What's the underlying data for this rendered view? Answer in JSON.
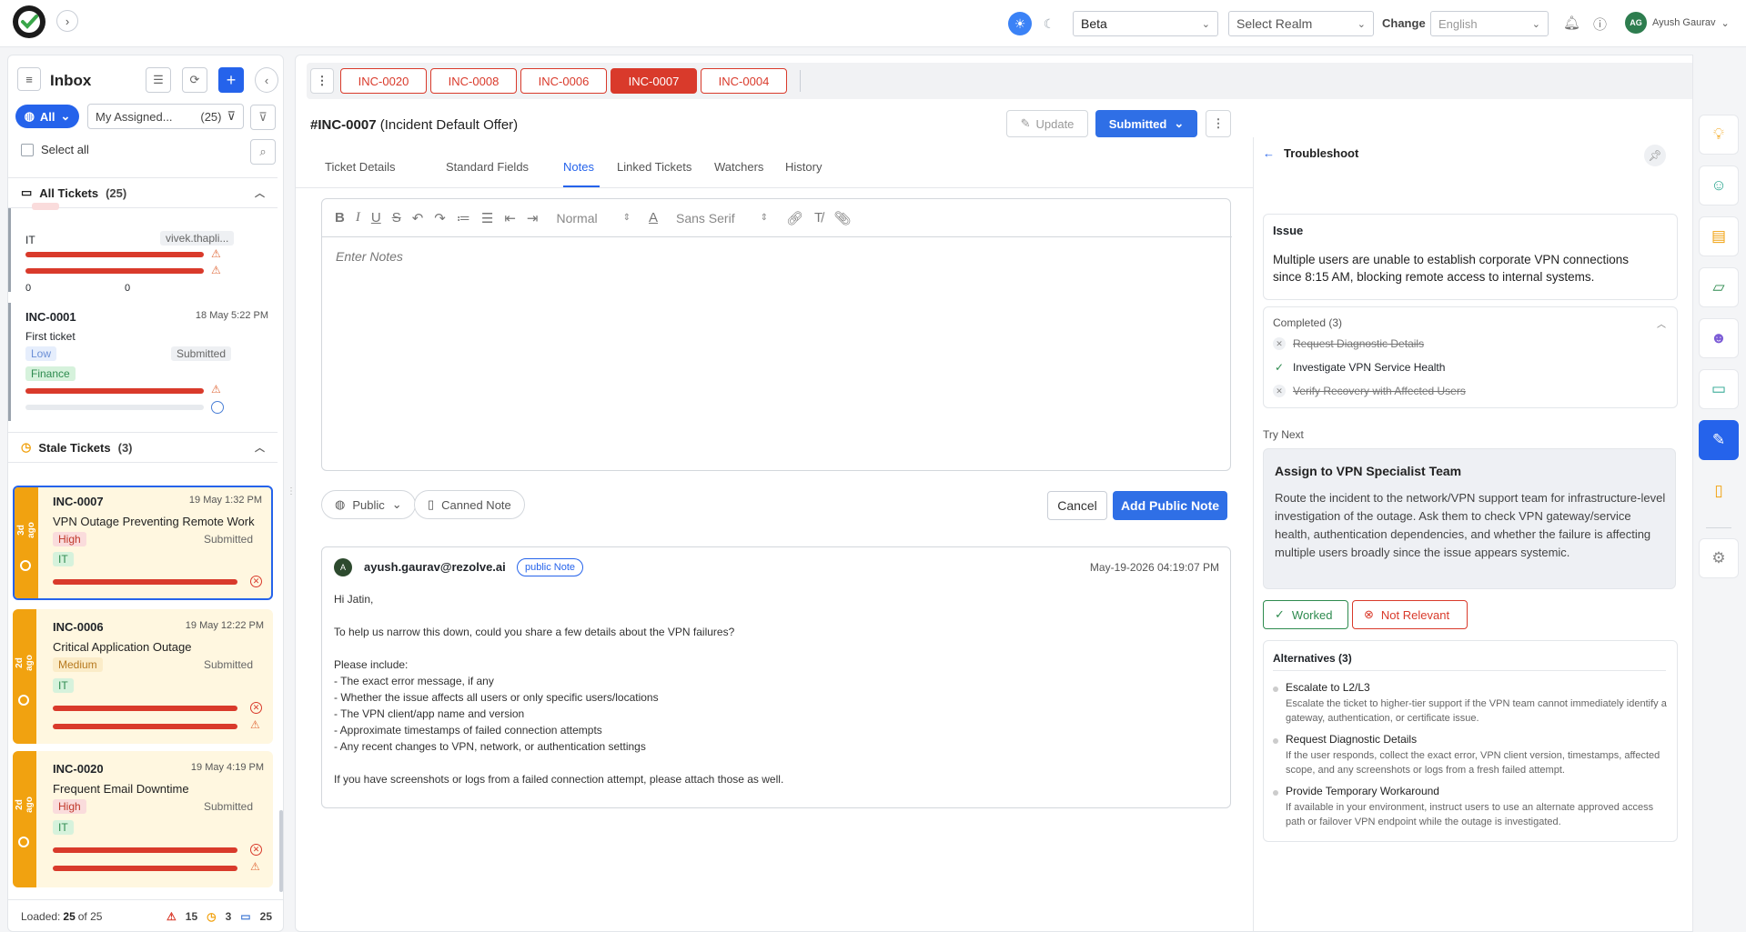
{
  "topbar": {
    "env": "Beta",
    "realm_placeholder": "Select Realm",
    "change_label": "Change",
    "language": "English",
    "user_initials": "AG",
    "user_name": "Ayush Gaurav"
  },
  "inbox": {
    "title": "Inbox",
    "all_label": "All",
    "my_assigned": "My Assigned...",
    "my_assigned_count": "(25)",
    "select_all": "Select all",
    "all_tickets": {
      "label": "All Tickets",
      "count": "(25)"
    },
    "partial_ticket": {
      "dept": "IT",
      "assignee": "vivek.thapli...",
      "count_a": "0",
      "count_b": "0"
    },
    "tickets": [
      {
        "id": "INC-0001",
        "date": "18 May 5:22 PM",
        "title": "First ticket",
        "priority": "Low",
        "status": "Submitted",
        "dept": "Finance"
      }
    ],
    "stale_tickets": {
      "label": "Stale Tickets",
      "count": "(3)"
    },
    "stale": [
      {
        "id": "INC-0007",
        "date": "19 May 1:32 PM",
        "title": "VPN Outage Preventing Remote Work",
        "priority": "High",
        "status": "Submitted",
        "dept": "IT",
        "age": "3d ago"
      },
      {
        "id": "INC-0006",
        "date": "19 May 12:22 PM",
        "title": "Critical Application Outage",
        "priority": "Medium",
        "status": "Submitted",
        "dept": "IT",
        "age": "2d ago"
      },
      {
        "id": "INC-0020",
        "date": "19 May 4:19 PM",
        "title": "Frequent Email Downtime",
        "priority": "High",
        "status": "Submitted",
        "dept": "IT",
        "age": "2d ago"
      }
    ],
    "footer": {
      "loaded_label": "Loaded:",
      "loaded": "25",
      "of": "of 25",
      "warn": "15",
      "clock": "3",
      "folder": "25"
    }
  },
  "tabs": [
    "INC-0020",
    "INC-0008",
    "INC-0006",
    "INC-0007",
    "INC-0004"
  ],
  "active_tab": "INC-0007",
  "ticket": {
    "id": "#INC-0007",
    "subtitle": "(Incident Default Offer)",
    "update_label": "Update",
    "status_label": "Submitted"
  },
  "detail_tabs": [
    "Ticket Details",
    "Standard Fields",
    "Notes",
    "Linked Tickets",
    "Watchers",
    "History"
  ],
  "editor": {
    "font_size": "Normal",
    "font_family": "Sans Serif",
    "placeholder": "Enter Notes",
    "visibility": "Public",
    "canned": "Canned Note",
    "cancel": "Cancel",
    "add": "Add Public Note"
  },
  "note": {
    "avatar": "A",
    "author": "ayush.gaurav@rezolve.ai",
    "badge": "public Note",
    "date": "May-19-2026 04:19:07 PM",
    "lines": [
      "Hi Jatin,",
      "",
      "To help us narrow this down, could you share a few details about the VPN failures?",
      "",
      "Please include:",
      "- The exact error message, if any",
      "- Whether the issue affects all users or only specific users/locations",
      "- The VPN client/app name and version",
      "- Approximate timestamps of failed connection attempts",
      "- Any recent changes to VPN, network, or authentication settings",
      "",
      "If you have screenshots or logs from a failed connection attempt, please attach those as well."
    ]
  },
  "troubleshoot": {
    "title": "Troubleshoot",
    "issue_label": "Issue",
    "issue_text": "Multiple users are unable to establish corporate VPN connections since 8:15 AM, blocking remote access to internal systems.",
    "completed_label": "Completed (3)",
    "completed": [
      {
        "label": "Request Diagnostic Details",
        "state": "skipped"
      },
      {
        "label": "Investigate VPN Service Health",
        "state": "done"
      },
      {
        "label": "Verify Recovery with Affected Users",
        "state": "skipped"
      }
    ],
    "try_next_label": "Try Next",
    "try_title": "Assign to VPN Specialist Team",
    "try_desc": "Route the incident to the network/VPN support team for infrastructure-level investigation of the outage. Ask them to check VPN gateway/service health, authentication dependencies, and whether the failure is affecting multiple users broadly since the issue appears systemic.",
    "worked": "Worked",
    "not_relevant": "Not Relevant",
    "alternatives_label": "Alternatives (3)",
    "alternatives": [
      {
        "title": "Escalate to L2/L3",
        "desc": "Escalate the ticket to higher-tier support if the VPN team cannot immediately identify a gateway, authentication, or certificate issue."
      },
      {
        "title": "Request Diagnostic Details",
        "desc": "If the user responds, collect the exact error, VPN client version, timestamps, affected scope, and any screenshots or logs from a fresh failed attempt."
      },
      {
        "title": "Provide Temporary Workaround",
        "desc": "If available in your environment, instruct users to use an alternate approved access path or failover VPN endpoint while the outage is investigated."
      }
    ]
  },
  "colors": {
    "accent": "#2563eb",
    "danger": "#d93a2b",
    "stale": "#f1a210",
    "success": "#2e8b4f"
  }
}
